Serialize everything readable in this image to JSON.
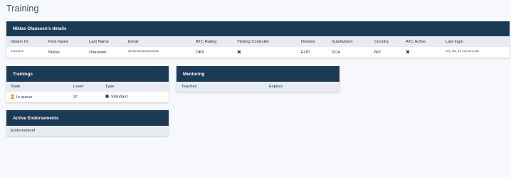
{
  "page": {
    "title": "Training"
  },
  "details": {
    "header": "Niklas Olaussen's details",
    "columns": [
      "Vatsim ID",
      "First Name",
      "Last Name",
      "Email",
      "ATC Rating",
      "Visiting Controller",
      "Division",
      "Subdivision",
      "Country",
      "ATC Active",
      "Last login"
    ],
    "row": {
      "vatsim_id": "********",
      "first_name": "Niklas",
      "last_name": "Olaussen",
      "email": "*******************",
      "atc_rating": "OBS",
      "visiting_controller_icon": "cross-icon",
      "division": "EUD",
      "subdivision": "SCA",
      "country": "NO",
      "atc_active_icon": "cross-icon",
      "last_login": "***-***-** ***:***:***"
    }
  },
  "trainings": {
    "header": "Trainings",
    "columns": [
      "State",
      "Level",
      "Type"
    ],
    "row": {
      "state_icon": "hourglass-icon",
      "state": "In queue",
      "level": "S*",
      "type_icon": "circle-icon",
      "type": "Standard"
    }
  },
  "mentoring": {
    "header": "Mentoring",
    "columns": [
      "Teaches",
      "Expires"
    ]
  },
  "endorsements": {
    "header": "Active Endorsements",
    "columns": [
      "Endorsement"
    ]
  },
  "colors": {
    "header_bg": "#1b3a55",
    "table_head_bg": "#e9ebf3",
    "page_bg": "#f7f8fc",
    "hourglass": "#e0a21b"
  }
}
